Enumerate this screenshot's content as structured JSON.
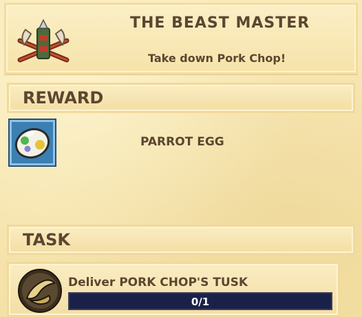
{
  "quest": {
    "title": "THE BEAST MASTER",
    "subtitle": "Take down Pork Chop!",
    "icon": "crossbow-skull-icon"
  },
  "reward": {
    "section_label": "REWARD",
    "item_name": "PARROT EGG",
    "item_icon": "parrot-egg-icon",
    "slot_color": "#3c7fb2"
  },
  "task": {
    "section_label": "TASK",
    "description": "Deliver PORK CHOP'S TUSK",
    "icon": "tusk-icon",
    "progress_text": "0/1",
    "progress_fraction": 0,
    "track_color": "#1a2148"
  }
}
